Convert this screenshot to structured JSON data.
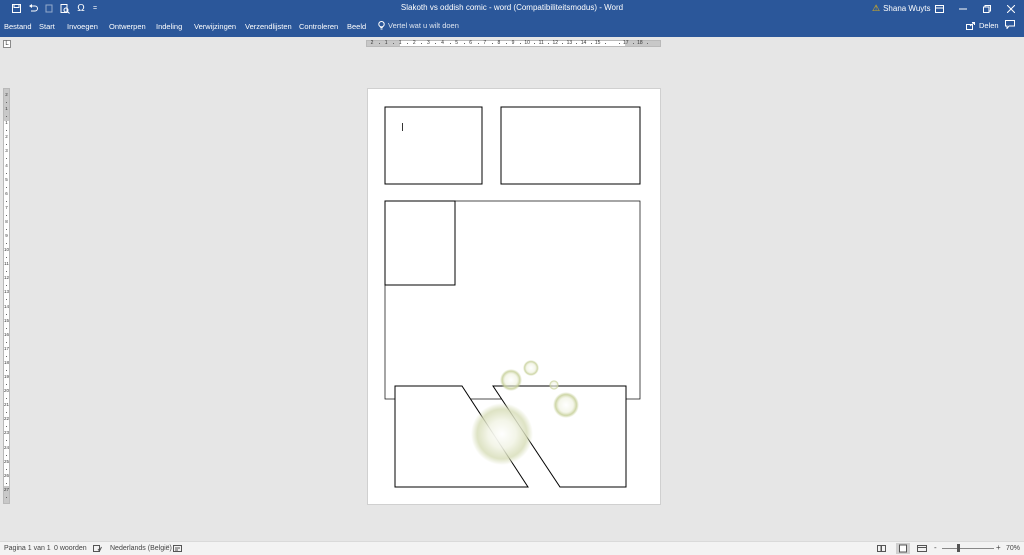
{
  "window": {
    "title": "Slakoth vs oddish comic - word (Compatibiliteitsmodus)  -  Word",
    "user": "Shana Wuyts"
  },
  "quick_access": {
    "icons": [
      "save-icon",
      "undo-icon",
      "redo-icon",
      "print-preview-icon",
      "symbol-icon",
      "customize-icon"
    ],
    "symbol_label": "Ω",
    "more_label": "="
  },
  "ribbon": {
    "tabs": [
      "Bestand",
      "Start",
      "Invoegen",
      "Ontwerpen",
      "Indeling",
      "Verwijzingen",
      "Verzendlijsten",
      "Controleren",
      "Beeld"
    ],
    "tell_me": "Vertel wat u wilt doen",
    "share": "Delen"
  },
  "rulers": {
    "horizontal_labels": [
      "2",
      "1",
      "1",
      "2",
      "3",
      "4",
      "5",
      "6",
      "7",
      "8",
      "9",
      "10",
      "11",
      "12",
      "13",
      "14",
      "15",
      "",
      "17",
      "18"
    ],
    "vertical_labels": [
      "2",
      "1",
      "1",
      "2",
      "3",
      "4",
      "5",
      "6",
      "7",
      "8",
      "9",
      "10",
      "11",
      "12",
      "13",
      "14",
      "15",
      "16",
      "17",
      "18",
      "19",
      "20",
      "21",
      "22",
      "23",
      "24",
      "25",
      "26",
      "27"
    ]
  },
  "statusbar": {
    "page": "Pagina 1 van 1",
    "words": "0 woorden",
    "language": "Nederlands (België)",
    "zoom": "70%",
    "zoom_minus": "-",
    "zoom_plus": "+"
  }
}
